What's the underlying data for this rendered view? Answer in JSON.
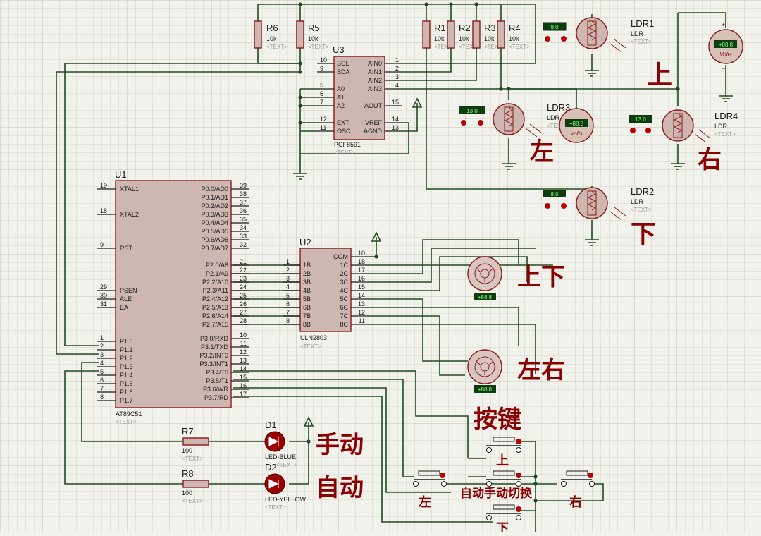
{
  "labels": {
    "up_top": "上",
    "left": "左",
    "right": "右",
    "down": "下",
    "updown": "上下",
    "leftright": "左右",
    "buttons": "按键",
    "manual": "手动",
    "auto": "自动",
    "btn_up": "上",
    "btn_left": "左",
    "btn_right": "右",
    "btn_switch": "自动手动切换",
    "btn_down": "下"
  },
  "placeholder": "<TEXT>",
  "resistors": [
    {
      "ref": "R6",
      "value": "10k"
    },
    {
      "ref": "R5",
      "value": "10k"
    },
    {
      "ref": "R1",
      "value": "10k"
    },
    {
      "ref": "R2",
      "value": "10k"
    },
    {
      "ref": "R3",
      "value": "10k"
    },
    {
      "ref": "R4",
      "value": "10k"
    },
    {
      "ref": "R7",
      "value": "100"
    },
    {
      "ref": "R8",
      "value": "100"
    }
  ],
  "ldrs": [
    {
      "ref": "LDR1",
      "type": "LDR",
      "meter": "8.0"
    },
    {
      "ref": "LDR2",
      "type": "LDR",
      "meter": "8.0"
    },
    {
      "ref": "LDR3",
      "type": "LDR",
      "meter": "13.0"
    },
    {
      "ref": "LDR4",
      "type": "LDR",
      "meter": "13.0"
    }
  ],
  "voltmeters": [
    {
      "reading": "+88.8",
      "unit": "Volts"
    },
    {
      "reading": "+88.8",
      "unit": "Volts"
    }
  ],
  "u1": {
    "ref": "U1",
    "part": "AT89C51",
    "left_pins": [
      {
        "n": "19",
        "name": "XTAL1"
      },
      {
        "n": "18",
        "name": "XTAL2"
      },
      {
        "n": "9",
        "name": "RST"
      },
      {
        "n": "29",
        "name": "PSEN"
      },
      {
        "n": "30",
        "name": "ALE"
      },
      {
        "n": "31",
        "name": "EA"
      },
      {
        "n": "1",
        "name": "P1.0"
      },
      {
        "n": "2",
        "name": "P1.1"
      },
      {
        "n": "3",
        "name": "P1.2"
      },
      {
        "n": "4",
        "name": "P1.3"
      },
      {
        "n": "5",
        "name": "P1.4"
      },
      {
        "n": "6",
        "name": "P1.5"
      },
      {
        "n": "7",
        "name": "P1.6"
      },
      {
        "n": "8",
        "name": "P1.7"
      }
    ],
    "right_pins": [
      {
        "n": "39",
        "name": "P0.0/AD0"
      },
      {
        "n": "38",
        "name": "P0.1/AD1"
      },
      {
        "n": "37",
        "name": "P0.2/AD2"
      },
      {
        "n": "36",
        "name": "P0.3/AD3"
      },
      {
        "n": "35",
        "name": "P0.4/AD4"
      },
      {
        "n": "34",
        "name": "P0.5/AD5"
      },
      {
        "n": "33",
        "name": "P0.6/AD6"
      },
      {
        "n": "32",
        "name": "P0.7/AD7"
      },
      {
        "n": "21",
        "name": "P2.0/A8"
      },
      {
        "n": "22",
        "name": "P2.1/A9"
      },
      {
        "n": "23",
        "name": "P2.2/A10"
      },
      {
        "n": "24",
        "name": "P2.3/A11"
      },
      {
        "n": "25",
        "name": "P2.4/A12"
      },
      {
        "n": "26",
        "name": "P2.5/A13"
      },
      {
        "n": "27",
        "name": "P2.6/A14"
      },
      {
        "n": "28",
        "name": "P2.7/A15"
      },
      {
        "n": "10",
        "name": "P3.0/RXD"
      },
      {
        "n": "11",
        "name": "P3.1/TXD"
      },
      {
        "n": "12",
        "name": "P3.2/INT0"
      },
      {
        "n": "13",
        "name": "P3.3/INT1"
      },
      {
        "n": "14",
        "name": "P3.4/T0"
      },
      {
        "n": "15",
        "name": "P3.5/T1"
      },
      {
        "n": "16",
        "name": "P3.6/WR"
      },
      {
        "n": "17",
        "name": "P3.7/RD"
      }
    ]
  },
  "u2": {
    "ref": "U2",
    "part": "ULN2803",
    "left_pins": [
      {
        "n": "1",
        "name": "1B"
      },
      {
        "n": "2",
        "name": "2B"
      },
      {
        "n": "3",
        "name": "3B"
      },
      {
        "n": "4",
        "name": "4B"
      },
      {
        "n": "5",
        "name": "5B"
      },
      {
        "n": "6",
        "name": "6B"
      },
      {
        "n": "7",
        "name": "7B"
      },
      {
        "n": "8",
        "name": "8B"
      }
    ],
    "right_pins": [
      {
        "n": "10",
        "name": "COM"
      },
      {
        "n": "18",
        "name": "1C"
      },
      {
        "n": "17",
        "name": "2C"
      },
      {
        "n": "16",
        "name": "3C"
      },
      {
        "n": "15",
        "name": "4C"
      },
      {
        "n": "14",
        "name": "5C"
      },
      {
        "n": "13",
        "name": "6C"
      },
      {
        "n": "12",
        "name": "7C"
      },
      {
        "n": "11",
        "name": "8C"
      }
    ]
  },
  "u3": {
    "ref": "U3",
    "part": "PCF8591",
    "left_pins": [
      {
        "n": "10",
        "name": "SCL"
      },
      {
        "n": "9",
        "name": "SDA"
      },
      {
        "n": "5",
        "name": "A0"
      },
      {
        "n": "6",
        "name": "A1"
      },
      {
        "n": "7",
        "name": "A2"
      },
      {
        "n": "12",
        "name": "EXT"
      },
      {
        "n": "11",
        "name": "OSC"
      }
    ],
    "right_pins": [
      {
        "n": "1",
        "name": "AIN0"
      },
      {
        "n": "2",
        "name": "AIN1"
      },
      {
        "n": "3",
        "name": "AIN2"
      },
      {
        "n": "4",
        "name": "AIN3"
      },
      {
        "n": "15",
        "name": "AOUT"
      },
      {
        "n": "14",
        "name": "VREF"
      },
      {
        "n": "13",
        "name": "AGND"
      }
    ]
  },
  "leds": [
    {
      "ref": "D1",
      "part": "LED-BLUE"
    },
    {
      "ref": "D2",
      "part": "LED-YELLOW"
    }
  ],
  "motor_displays": [
    "+88.8",
    "+88.8"
  ]
}
